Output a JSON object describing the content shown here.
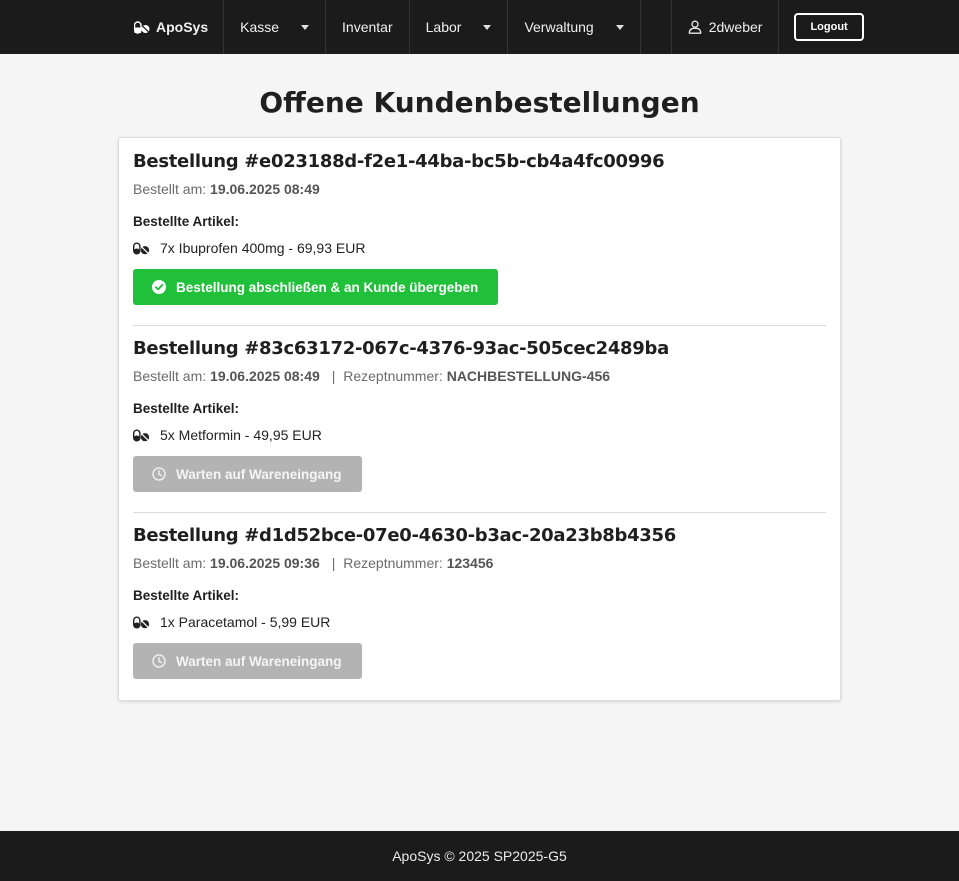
{
  "navbar": {
    "brand": "ApoSys",
    "items": [
      {
        "label": "Kasse",
        "dropdown": true
      },
      {
        "label": "Inventar",
        "dropdown": false
      },
      {
        "label": "Labor",
        "dropdown": true
      },
      {
        "label": "Verwaltung",
        "dropdown": true
      }
    ],
    "user": "2dweber",
    "logout_label": "Logout"
  },
  "page": {
    "title": "Offene Kundenbestellungen"
  },
  "orders": [
    {
      "title": "Bestellung #e023188d-f2e1-44ba-bc5b-cb4a4fc00996",
      "ordered_label": "Bestellt am:",
      "ordered_at": "19.06.2025 08:49",
      "prescription_label": "",
      "prescription": "",
      "items_heading": "Bestellte Artikel:",
      "items": [
        "7x Ibuprofen 400mg - 69,93 EUR"
      ],
      "button_label": "Bestellung abschließen & an Kunde übergeben",
      "button_state": "ready"
    },
    {
      "title": "Bestellung #83c63172-067c-4376-93ac-505cec2489ba",
      "ordered_label": "Bestellt am:",
      "ordered_at": "19.06.2025 08:49",
      "prescription_label": "Rezeptnummer:",
      "prescription": "NACHBESTELLUNG-456",
      "items_heading": "Bestellte Artikel:",
      "items": [
        "5x Metformin - 49,95 EUR"
      ],
      "button_label": "Warten auf Wareneingang",
      "button_state": "waiting"
    },
    {
      "title": "Bestellung #d1d52bce-07e0-4630-b3ac-20a23b8b4356",
      "ordered_label": "Bestellt am:",
      "ordered_at": "19.06.2025 09:36",
      "prescription_label": "Rezeptnummer:",
      "prescription": "123456",
      "items_heading": "Bestellte Artikel:",
      "items": [
        "1x Paracetamol - 5,99 EUR"
      ],
      "button_label": "Warten auf Wareneingang",
      "button_state": "waiting"
    }
  ],
  "footer": {
    "text": "ApoSys © 2025 SP2025-G5"
  },
  "icons": {
    "brand": "pills-icon",
    "user": "user-icon",
    "item": "pills-icon",
    "ready_button": "check-circle-icon",
    "waiting_button": "clock-icon"
  },
  "colors": {
    "navbar_bg": "#1b1b1b",
    "success": "#21c03b",
    "disabled": "#b3b3b3"
  }
}
